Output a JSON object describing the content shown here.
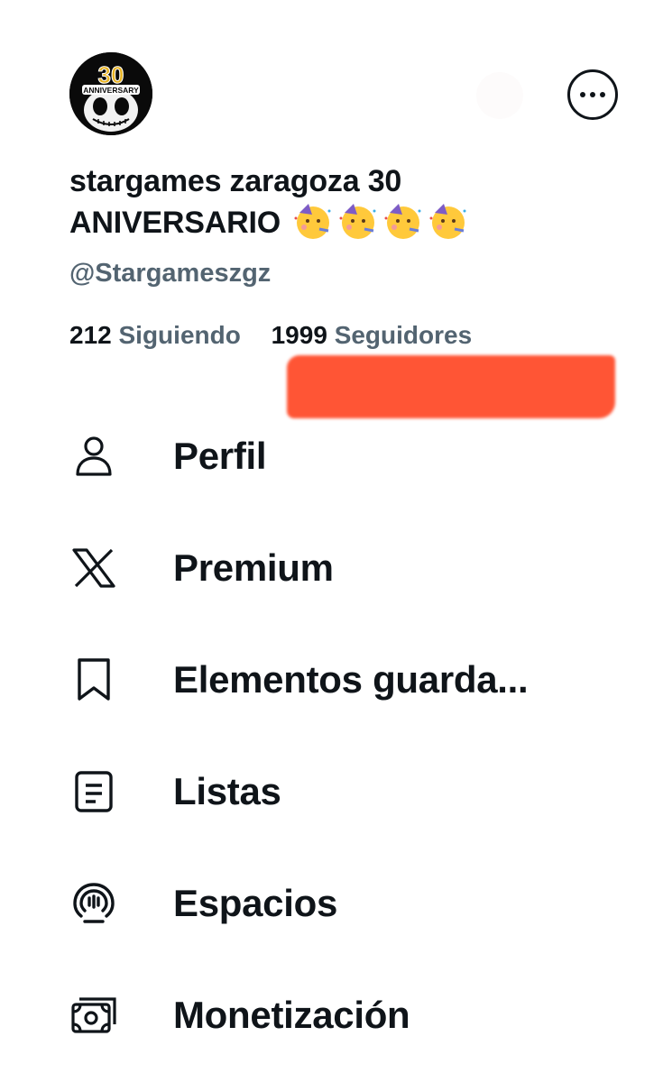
{
  "profile": {
    "avatar_text_top": "30",
    "avatar_text_bottom": "ANNIVERSARY",
    "display_name": "stargames zaragoza 30 ANIVERSARIO",
    "display_name_emojis": [
      "partying-face-emoji",
      "partying-face-emoji",
      "partying-face-emoji",
      "partying-face-emoji"
    ],
    "handle": "@Stargameszgz",
    "following_count": "212",
    "following_label": "Siguiendo",
    "followers_count": "1999",
    "followers_label": "Seguidores"
  },
  "header": {
    "more_icon": "more-horizontal-icon"
  },
  "colors": {
    "text_primary": "#0f1419",
    "text_secondary": "#536471",
    "redaction": "#ff5535"
  },
  "menu": {
    "items": [
      {
        "label": "Perfil",
        "icon": "person-icon"
      },
      {
        "label": "Premium",
        "icon": "x-logo-icon"
      },
      {
        "label": "Elementos guarda...",
        "icon": "bookmark-icon"
      },
      {
        "label": "Listas",
        "icon": "list-icon"
      },
      {
        "label": "Espacios",
        "icon": "spaces-icon"
      },
      {
        "label": "Monetización",
        "icon": "money-icon"
      }
    ]
  }
}
